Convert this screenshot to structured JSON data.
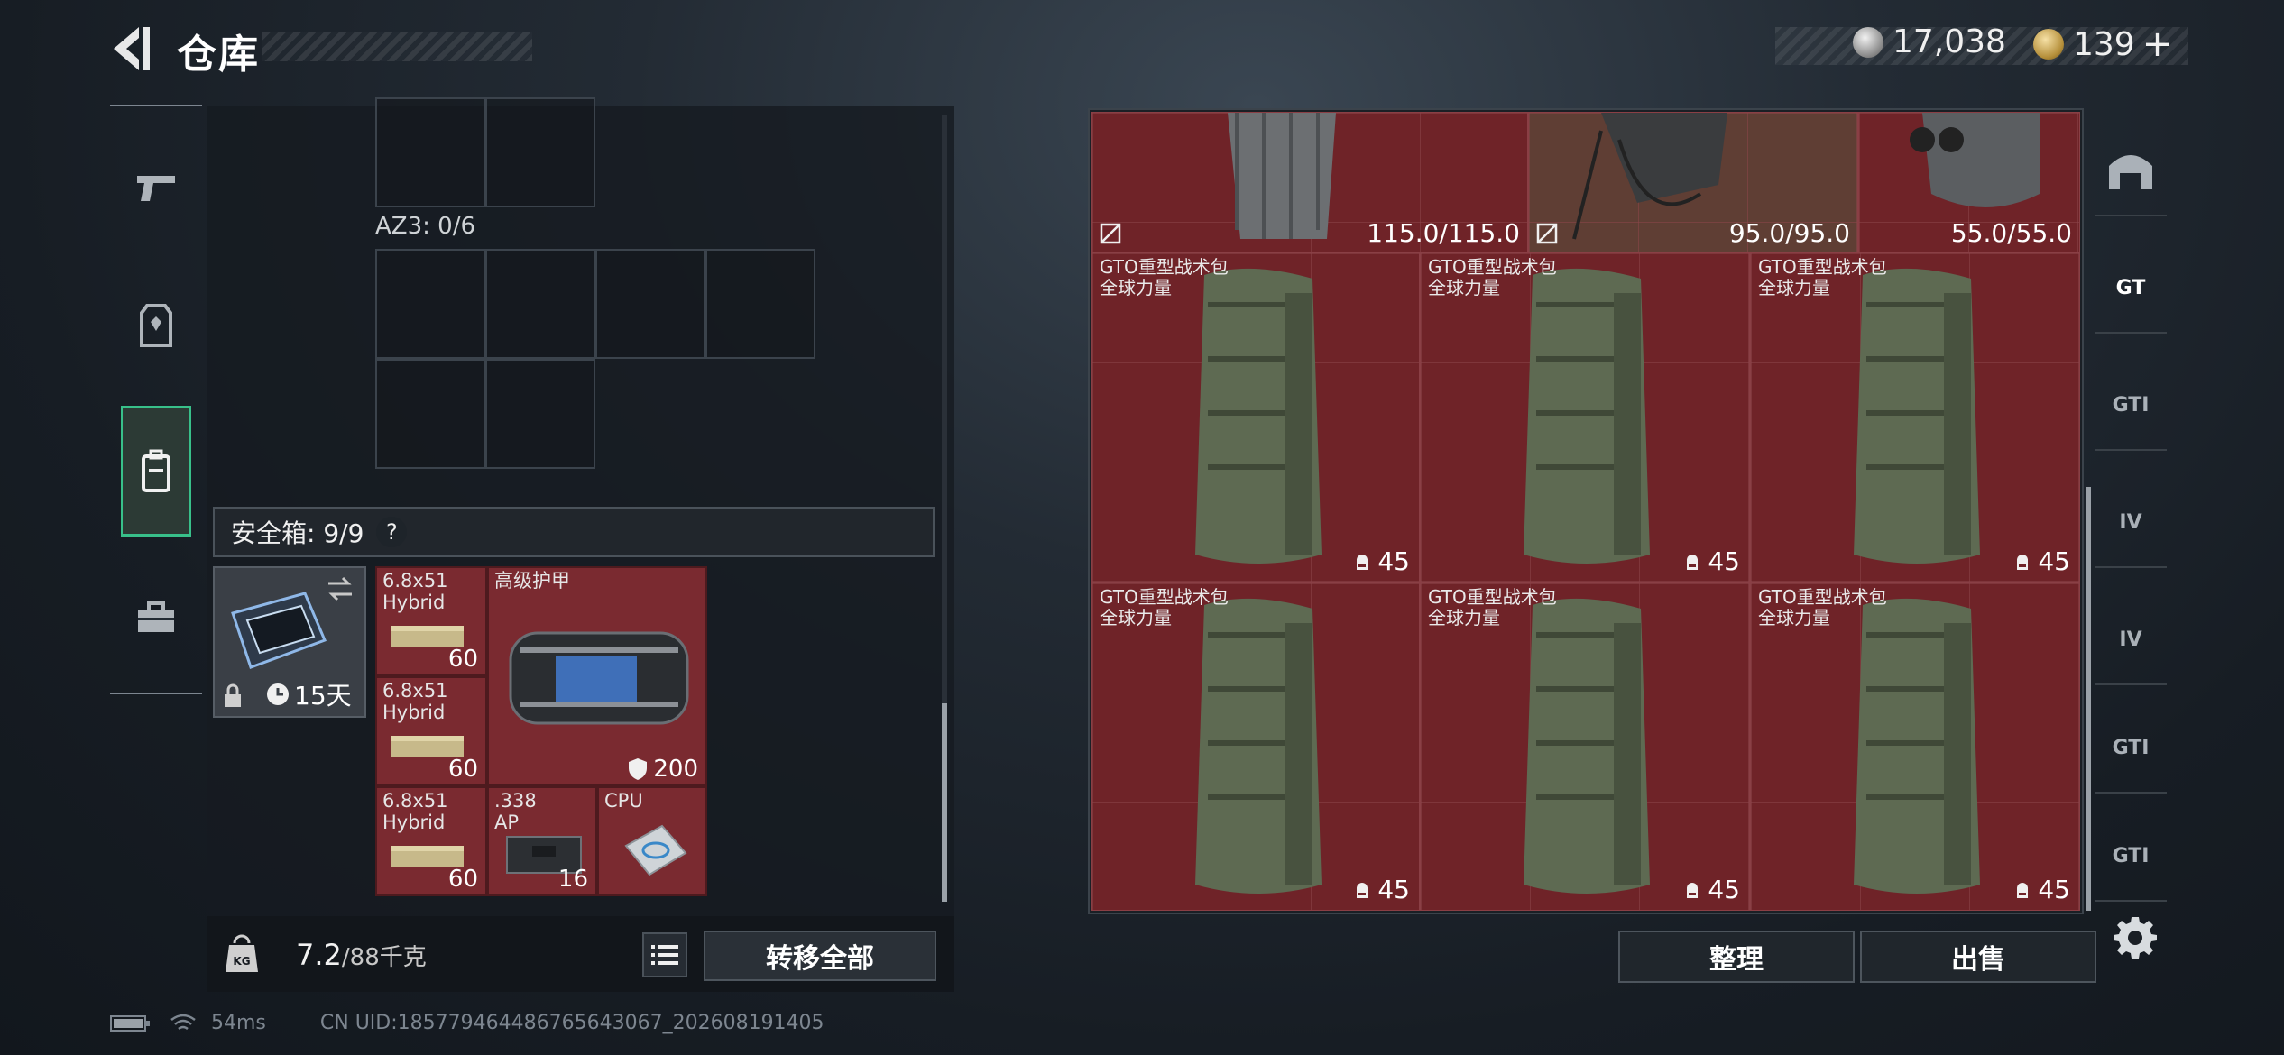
{
  "header": {
    "title": "仓库",
    "currency_silver": "17,038",
    "currency_gold": "139"
  },
  "gear": {
    "az3_label": "AZ3: 0/6"
  },
  "safe_box": {
    "label": "安全箱: 9/9",
    "help": "?",
    "case_days": "15天",
    "items": [
      {
        "name": "6.8x51\nHybrid",
        "qty": "60"
      },
      {
        "name": "6.8x51\nHybrid",
        "qty": "60"
      },
      {
        "name": "6.8x51\nHybrid",
        "qty": "60"
      },
      {
        "name": "高级护甲",
        "qty": "200"
      },
      {
        "name": ".338\nAP",
        "qty": "16"
      },
      {
        "name": "CPU",
        "qty": ""
      }
    ]
  },
  "weight": {
    "current": "7.2",
    "max": "/88千克"
  },
  "buttons": {
    "transfer_all": "转移全部",
    "sort": "整理",
    "sell": "出售"
  },
  "stash": {
    "top_items": [
      {
        "durability": "115.0/115.0"
      },
      {
        "durability": "95.0/95.0"
      },
      {
        "durability": "55.0/55.0"
      }
    ],
    "backpacks": [
      {
        "name": "GTO重型战术包",
        "brand": "全球力量",
        "capacity": "45"
      },
      {
        "name": "GTO重型战术包",
        "brand": "全球力量",
        "capacity": "45"
      },
      {
        "name": "GTO重型战术包",
        "brand": "全球力量",
        "capacity": "45"
      },
      {
        "name": "GTO重型战术包",
        "brand": "全球力量",
        "capacity": "45"
      },
      {
        "name": "GTO重型战术包",
        "brand": "全球力量",
        "capacity": "45"
      },
      {
        "name": "GTO重型战术包",
        "brand": "全球力量",
        "capacity": "45"
      }
    ]
  },
  "right_tabs": [
    "GT",
    "GTI",
    "IV",
    "IV",
    "GTI",
    "GTI"
  ],
  "status": {
    "ping": "54ms",
    "uid": "CN UID:18577946448676564306​7_202608191405"
  },
  "colors": {
    "accent_green": "#38c08a",
    "slot_red": "#6f2328"
  }
}
